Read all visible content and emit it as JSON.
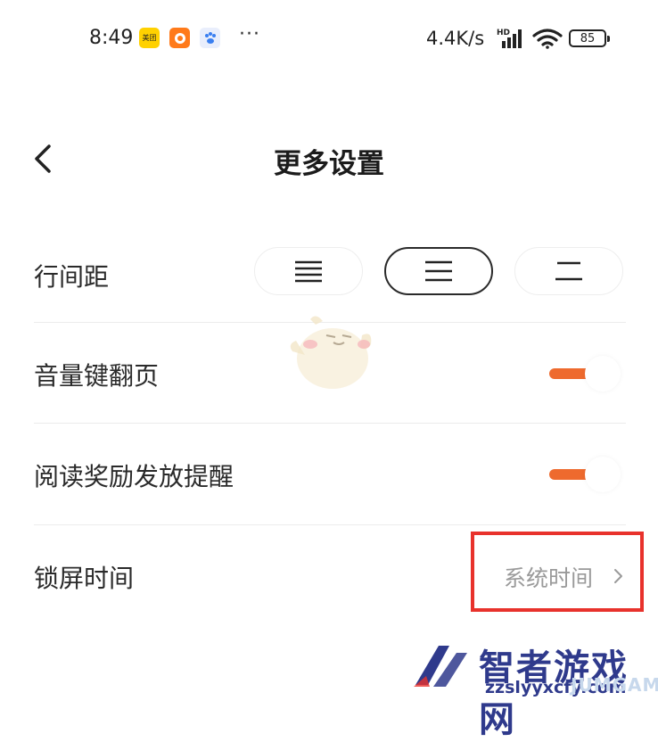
{
  "status_bar": {
    "time": "8:49",
    "apps": [
      {
        "name": "美团",
        "icon": "meituan-icon",
        "color": "#ffd100"
      },
      {
        "name": "UC",
        "icon": "uc-browser-icon",
        "color": "#ff6a00"
      },
      {
        "name": "",
        "icon": "baidu-paw-icon",
        "color": "#3a7ff0"
      }
    ],
    "more": "···",
    "net_speed": "4.4K/s",
    "signal_badge": "HD",
    "battery": "85"
  },
  "header": {
    "back_icon": "chevron-left-icon",
    "title": "更多设置"
  },
  "settings": {
    "line_spacing": {
      "label": "行间距",
      "options": [
        "compact-lines-icon",
        "medium-lines-icon",
        "wide-lines-icon"
      ],
      "selected_index": 1
    },
    "volume_key_page_turn": {
      "label": "音量键翻页",
      "enabled": true
    },
    "reading_reward_reminder": {
      "label": "阅读奖励发放提醒",
      "enabled": true
    },
    "lock_screen_time": {
      "label": "锁屏时间",
      "value": "系统时间"
    }
  },
  "colors": {
    "accent": "#ee6a2e",
    "highlight_box": "#e8322c",
    "watermark": "#2f3a8c"
  },
  "watermark": {
    "text": "智者游戏网",
    "url": "zzslyyxcfy.com",
    "game": "JUMGAME"
  }
}
